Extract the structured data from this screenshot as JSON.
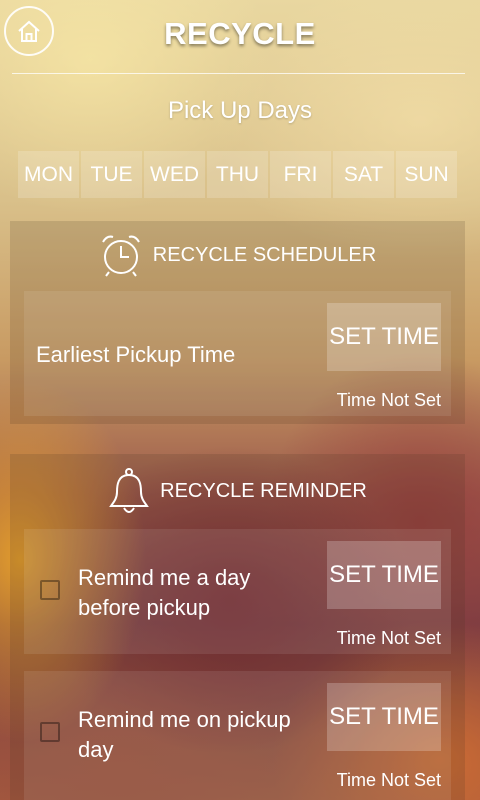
{
  "header": {
    "title": "RECYCLE",
    "home_icon": "home-icon"
  },
  "pickup": {
    "title": "Pick Up Days",
    "days": [
      "MON",
      "TUE",
      "WED",
      "THU",
      "FRI",
      "SAT",
      "SUN"
    ]
  },
  "scheduler": {
    "title": "RECYCLE SCHEDULER",
    "icon": "alarm-clock-icon",
    "item": {
      "label": "Earliest Pickup Time",
      "button": "SET TIME",
      "status": "Time Not Set"
    }
  },
  "reminder": {
    "title": "RECYCLE REMINDER",
    "icon": "bell-icon",
    "items": [
      {
        "label_line1": "Remind me a day",
        "label_line2": "before pickup",
        "button": "SET TIME",
        "status": "Time Not Set",
        "checked": false
      },
      {
        "label_line1": "Remind me on pickup",
        "label_line2": "day",
        "button": "SET TIME",
        "status": "Time Not Set",
        "checked": false
      }
    ]
  }
}
